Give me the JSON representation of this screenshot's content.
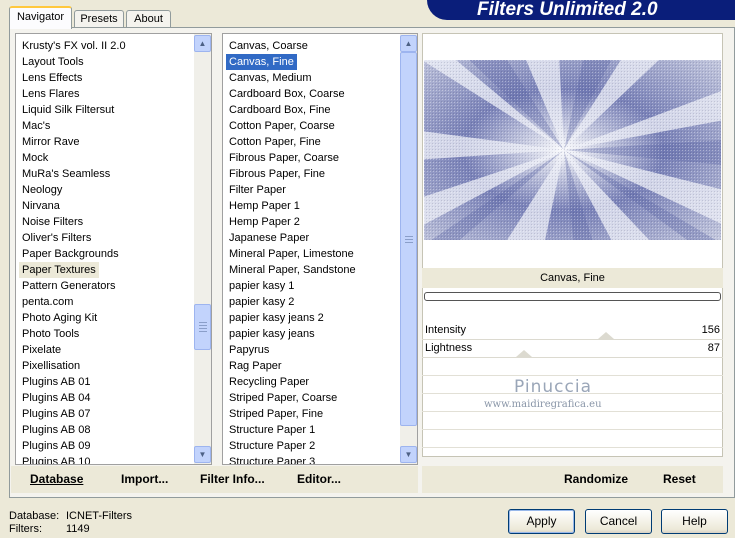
{
  "tabs": [
    {
      "label": "Navigator",
      "active": true
    },
    {
      "label": "Presets",
      "active": false
    },
    {
      "label": "About",
      "active": false
    }
  ],
  "banner_title": "Filters Unlimited 2.0",
  "categories": [
    "Krusty's FX vol. II 2.0",
    "Layout Tools",
    "Lens Effects",
    "Lens Flares",
    "Liquid Silk Filtersut",
    "Mac's",
    "Mirror Rave",
    "Mock",
    "MuRa's Seamless",
    "Neology",
    "Nirvana",
    "Noise Filters",
    "Oliver's Filters",
    "Paper Backgrounds",
    "Paper Textures",
    "Pattern Generators",
    "penta.com",
    "Photo Aging Kit",
    "Photo Tools",
    "Pixelate",
    "Pixellisation",
    "Plugins AB 01",
    "Plugins AB 04",
    "Plugins AB 07",
    "Plugins AB 08",
    "Plugins AB 09",
    "Plugins AB 10"
  ],
  "categories_selected": "Paper Textures",
  "filters": [
    "Canvas, Coarse",
    "Canvas, Fine",
    "Canvas, Medium",
    "Cardboard Box, Coarse",
    "Cardboard Box, Fine",
    "Cotton Paper, Coarse",
    "Cotton Paper, Fine",
    "Fibrous Paper, Coarse",
    "Fibrous Paper, Fine",
    "Filter Paper",
    "Hemp Paper 1",
    "Hemp Paper 2",
    "Japanese Paper",
    "Mineral Paper, Limestone",
    "Mineral Paper, Sandstone",
    "papier kasy 1",
    "papier kasy 2",
    "papier kasy jeans 2",
    "papier kasy jeans",
    "Papyrus",
    "Rag Paper",
    "Recycling Paper",
    "Striped Paper, Coarse",
    "Striped Paper, Fine",
    "Structure Paper 1",
    "Structure Paper 2",
    "Structure Paper 3"
  ],
  "filters_selected": "Canvas, Fine",
  "preview_filter_name": "Canvas, Fine",
  "params": [
    {
      "label": "Intensity",
      "value": "156",
      "level": 0.61
    },
    {
      "label": "Lightness",
      "value": "87",
      "level": 0.34
    }
  ],
  "watermark": {
    "name": "Pinuccia",
    "url": "www.maidiregrafica.eu"
  },
  "links": {
    "database": "Database",
    "import": "Import...",
    "filter_info": "Filter Info...",
    "editor": "Editor...",
    "randomize": "Randomize",
    "reset": "Reset"
  },
  "status": {
    "database_label": "Database:",
    "database_value": "ICNET-Filters",
    "filters_label": "Filters:",
    "filters_value": "1149"
  },
  "buttons": {
    "apply": "Apply",
    "cancel": "Cancel",
    "help": "Help"
  },
  "colors": {
    "banner": "#0a1e7a",
    "selection": "#316ac5",
    "preview_tint": "#6a74b0"
  }
}
